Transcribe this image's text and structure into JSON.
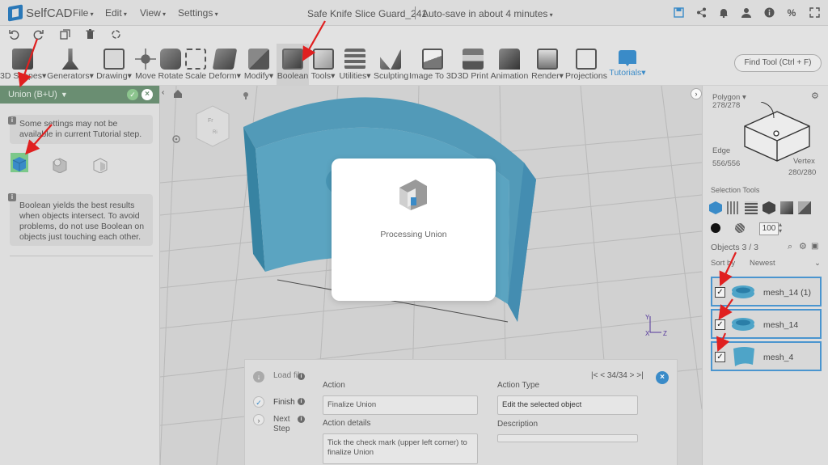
{
  "app": {
    "name": "SelfCAD"
  },
  "menu": [
    "File",
    "Edit",
    "View",
    "Settings"
  ],
  "document": {
    "title": "Safe Knife Slice Guard_241",
    "autosave": "Auto-save in about 4 minutes"
  },
  "toolbar": {
    "tools": [
      {
        "label": "3D Shapes",
        "dropdown": true
      },
      {
        "label": "Generators",
        "dropdown": true
      },
      {
        "label": "Drawing",
        "dropdown": true
      },
      {
        "label": "Move",
        "dropdown": false
      },
      {
        "label": "Rotate",
        "dropdown": false
      },
      {
        "label": "Scale",
        "dropdown": false
      },
      {
        "label": "Deform",
        "dropdown": true
      },
      {
        "label": "Modify",
        "dropdown": true
      },
      {
        "label": "Boolean",
        "dropdown": false
      },
      {
        "label": "Tools",
        "dropdown": true
      },
      {
        "label": "Utilities",
        "dropdown": true
      },
      {
        "label": "Sculpting",
        "dropdown": false
      },
      {
        "label": "Image To 3D",
        "dropdown": false
      },
      {
        "label": "3D Print",
        "dropdown": false
      },
      {
        "label": "Animation",
        "dropdown": false
      },
      {
        "label": "Render",
        "dropdown": true
      },
      {
        "label": "Projections",
        "dropdown": false
      },
      {
        "label": "Tutorials",
        "dropdown": true
      }
    ],
    "find_tool": "Find Tool (Ctrl + F)"
  },
  "left_panel": {
    "header": "Union (B+U)",
    "notice": "Some settings may not be available in current Tutorial step.",
    "tip": "Boolean yields the best results when objects intersect. To avoid problems, do not use Boolean on objects just touching each other."
  },
  "modal": {
    "text": "Processing Union"
  },
  "tutorial": {
    "steps": [
      {
        "label": "Load file",
        "status": "done"
      },
      {
        "label": "Finish",
        "status": "current"
      },
      {
        "label": "Next Step",
        "status": "pending"
      }
    ],
    "nav": "34/34",
    "action_label": "Action",
    "action_value": "Finalize Union",
    "action_details_label": "Action details",
    "action_details_value": "Tick the check mark (upper left corner) to finalize Union",
    "action_type_label": "Action Type",
    "action_type_value": "Edit the selected object",
    "description_label": "Description",
    "description_value": ""
  },
  "right_panel": {
    "polygon_label": "Polygon",
    "polygon_count": "278/278",
    "edge_label": "Edge",
    "edge_count": "556/556",
    "vertex_label": "Vertex",
    "vertex_count": "280/280",
    "selection_tools_label": "Selection Tools",
    "brush_size": "100",
    "objects_label": "Objects 3 / 3",
    "sort_label": "Sort by",
    "sort_value": "Newest",
    "objects": [
      {
        "name": "mesh_14 (1)",
        "checked": true,
        "shape": "ring"
      },
      {
        "name": "mesh_14",
        "checked": true,
        "shape": "ring"
      },
      {
        "name": "mesh_4",
        "checked": true,
        "shape": "arc"
      }
    ]
  },
  "colors": {
    "accent": "#3a8bc8",
    "model": "#5aa8c8",
    "union_header": "#6a8e72",
    "annotation": "#e02020"
  }
}
